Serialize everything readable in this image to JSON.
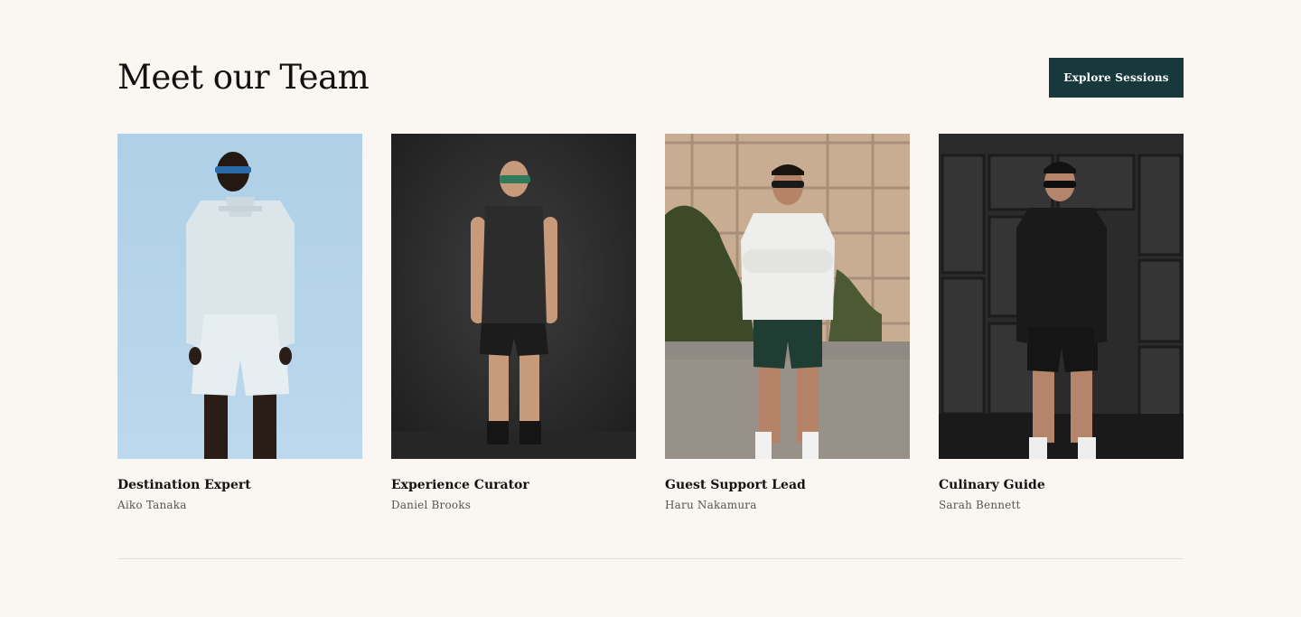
{
  "section": {
    "title": "Meet our Team",
    "cta_label": "Explore Sessions",
    "cta_color": "#17393d"
  },
  "team": [
    {
      "role": "Destination Expert",
      "name": "Aiko Tanaka",
      "photo": "athlete-white-outfit-blue-backdrop"
    },
    {
      "role": "Experience Curator",
      "name": "Daniel Brooks",
      "photo": "athlete-black-tank-dark-backdrop"
    },
    {
      "role": "Guest Support Lead",
      "name": "Haru Nakamura",
      "photo": "athlete-white-longsleeve-ivy-wall"
    },
    {
      "role": "Culinary Guide",
      "name": "Sarah Bennett",
      "photo": "athlete-black-longsleeve-metal-wall"
    }
  ]
}
